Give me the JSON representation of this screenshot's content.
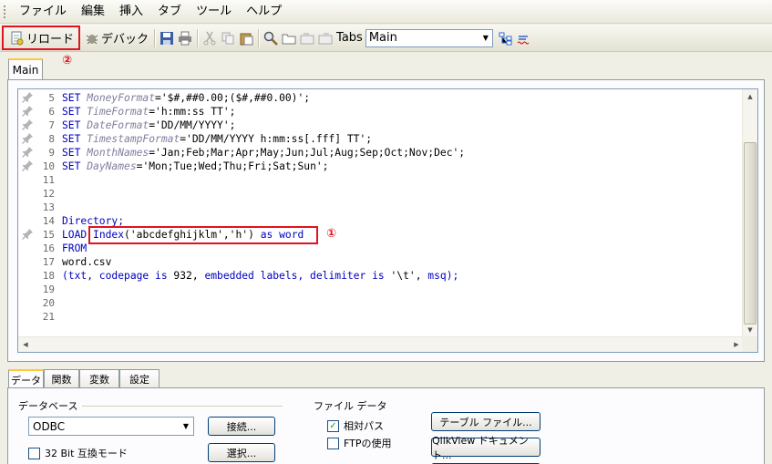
{
  "menu": [
    "ファイル",
    "編集",
    "挿入",
    "タブ",
    "ツール",
    "ヘルプ"
  ],
  "toolbar": {
    "reload_label": "リロード",
    "debug_label": "デバック",
    "tabs_label": "Tabs",
    "tab_select_value": "Main"
  },
  "markers": {
    "reload": "②",
    "highlight": "①"
  },
  "editor_tab": "Main",
  "code_lines": [
    {
      "n": "5",
      "pin": true,
      "html": "<span class='kw'>SET</span> <span class='var'>MoneyFormat</span>='$#,##0.00;($#,##0.00)';"
    },
    {
      "n": "6",
      "pin": true,
      "html": "<span class='kw'>SET</span> <span class='var'>TimeFormat</span>='h:mm:ss TT';"
    },
    {
      "n": "7",
      "pin": true,
      "html": "<span class='kw'>SET</span> <span class='var'>DateFormat</span>='DD/MM/YYYY';"
    },
    {
      "n": "8",
      "pin": true,
      "html": "<span class='kw'>SET</span> <span class='var'>TimestampFormat</span>='DD/MM/YYYY h:mm:ss[.fff] TT';"
    },
    {
      "n": "9",
      "pin": true,
      "html": "<span class='kw'>SET</span> <span class='var'>MonthNames</span>='Jan;Feb;Mar;Apr;May;Jun;Jul;Aug;Sep;Oct;Nov;Dec';"
    },
    {
      "n": "10",
      "pin": true,
      "html": "<span class='kw'>SET</span> <span class='var'>DayNames</span>='Mon;Tue;Wed;Thu;Fri;Sat;Sun';"
    },
    {
      "n": "11",
      "pin": false,
      "html": ""
    },
    {
      "n": "12",
      "pin": false,
      "html": ""
    },
    {
      "n": "13",
      "pin": false,
      "html": ""
    },
    {
      "n": "14",
      "pin": false,
      "html": "<span class='kw'>Directory;</span>"
    },
    {
      "n": "15",
      "pin": true,
      "html": "<span class='kw'>LOAD</span> <span class='fn'>Index</span>('abcdefghijklm','h') <span class='kw'>as</span> <span class='kw'>word</span>"
    },
    {
      "n": "16",
      "pin": false,
      "html": "<span class='kw'>FROM</span>"
    },
    {
      "n": "17",
      "pin": false,
      "html": "word.csv"
    },
    {
      "n": "18",
      "pin": false,
      "html": "<span class='kw'>(txt, codepage is</span> 932, <span class='kw'>embedded labels, delimiter is</span> '\\t', <span class='kw'>msq);</span>"
    },
    {
      "n": "19",
      "pin": false,
      "html": ""
    },
    {
      "n": "20",
      "pin": false,
      "html": ""
    },
    {
      "n": "21",
      "pin": false,
      "html": ""
    }
  ],
  "bottom_tabs": [
    "データ",
    "関数",
    "変数",
    "設定"
  ],
  "data_panel": {
    "database_label": "データベース",
    "database_value": "ODBC",
    "connect_button": "接続...",
    "select_button": "選択...",
    "compat_checkbox": "32 Bit 互換モード",
    "file_data_label": "ファイル データ",
    "relative_path": "相対パス",
    "use_ftp": "FTPの使用",
    "table_file_button": "テーブル ファイル...",
    "qlikview_doc_button": "QlikView ドキュメント..."
  }
}
